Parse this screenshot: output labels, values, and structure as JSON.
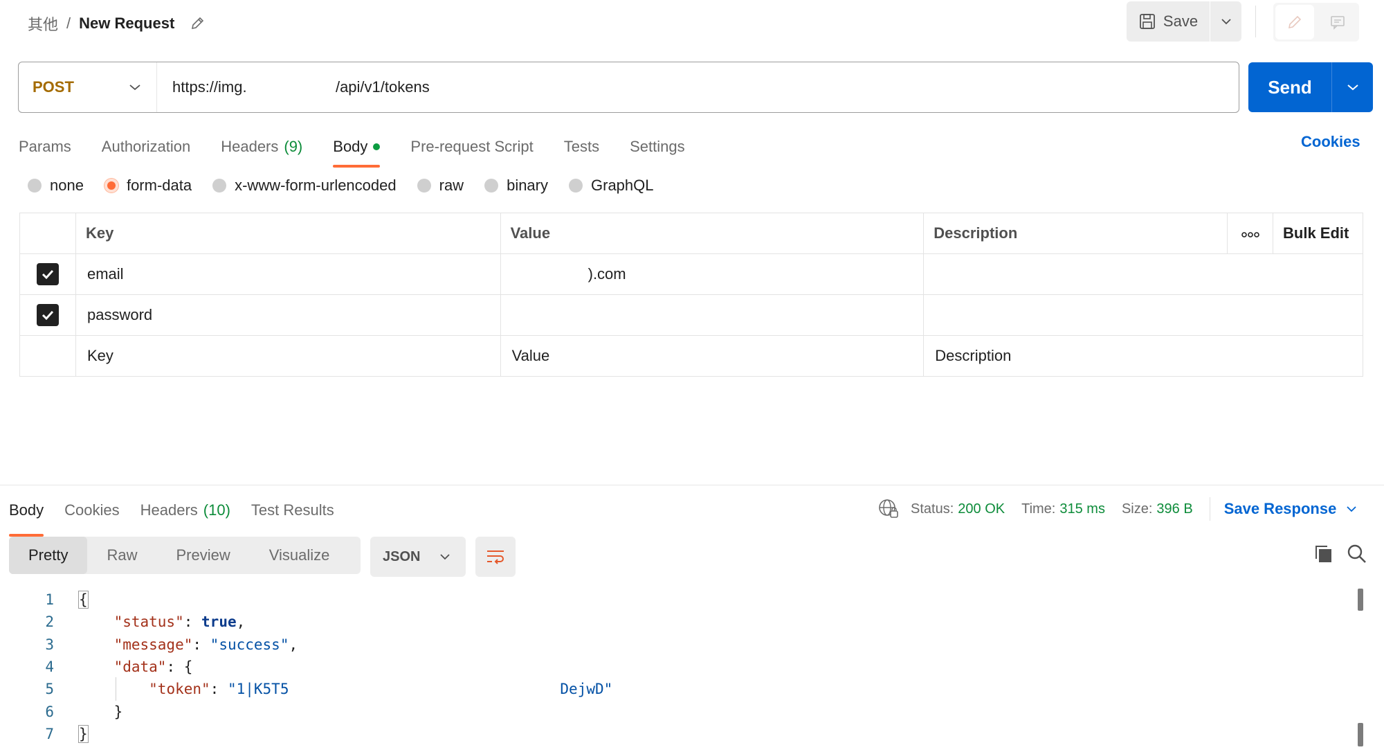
{
  "breadcrumb": {
    "parent": "其他",
    "separator": "/",
    "current": "New Request"
  },
  "toolbar": {
    "save_label": "Save"
  },
  "request": {
    "method": "POST",
    "url": "https://img.                     /api/v1/tokens",
    "send_label": "Send"
  },
  "request_tabs": {
    "params": "Params",
    "authorization": "Authorization",
    "headers": "Headers",
    "headers_count": "(9)",
    "body": "Body",
    "prerequest": "Pre-request Script",
    "tests": "Tests",
    "settings": "Settings",
    "cookies": "Cookies"
  },
  "body_types": {
    "none": "none",
    "form_data": "form-data",
    "urlencoded": "x-www-form-urlencoded",
    "raw": "raw",
    "binary": "binary",
    "graphql": "GraphQL",
    "selected": "form-data"
  },
  "params_table": {
    "headers": {
      "key": "Key",
      "value": "Value",
      "description": "Description",
      "bulk_edit": "Bulk Edit"
    },
    "rows": [
      {
        "checked": true,
        "key": "email",
        "value": "                  ).com",
        "description": ""
      },
      {
        "checked": true,
        "key": "password",
        "value": "",
        "description": ""
      }
    ],
    "placeholders": {
      "key": "Key",
      "value": "Value",
      "description": "Description"
    }
  },
  "response_tabs": {
    "body": "Body",
    "cookies": "Cookies",
    "headers": "Headers",
    "headers_count": "(10)",
    "test_results": "Test Results"
  },
  "response_status": {
    "status_label": "Status:",
    "status_value": "200 OK",
    "time_label": "Time:",
    "time_value": "315 ms",
    "size_label": "Size:",
    "size_value": "396 B",
    "save_response": "Save Response"
  },
  "view_modes": {
    "pretty": "Pretty",
    "raw": "Raw",
    "preview": "Preview",
    "visualize": "Visualize",
    "format": "JSON"
  },
  "code": {
    "line_numbers": [
      "1",
      "2",
      "3",
      "4",
      "5",
      "6",
      "7"
    ],
    "open_brace": "{",
    "status_key": "\"status\"",
    "status_val": "true",
    "message_key": "\"message\"",
    "message_val": "\"success\"",
    "data_key": "\"data\"",
    "token_key": "\"token\"",
    "token_val": "\"1|K5T5                               DejwD\"",
    "inner_close": "}",
    "close_brace": "}"
  },
  "colors": {
    "accent": "#ff6c37",
    "send": "#0265d2",
    "method": "#a46b00",
    "success": "#0d8c3a"
  }
}
